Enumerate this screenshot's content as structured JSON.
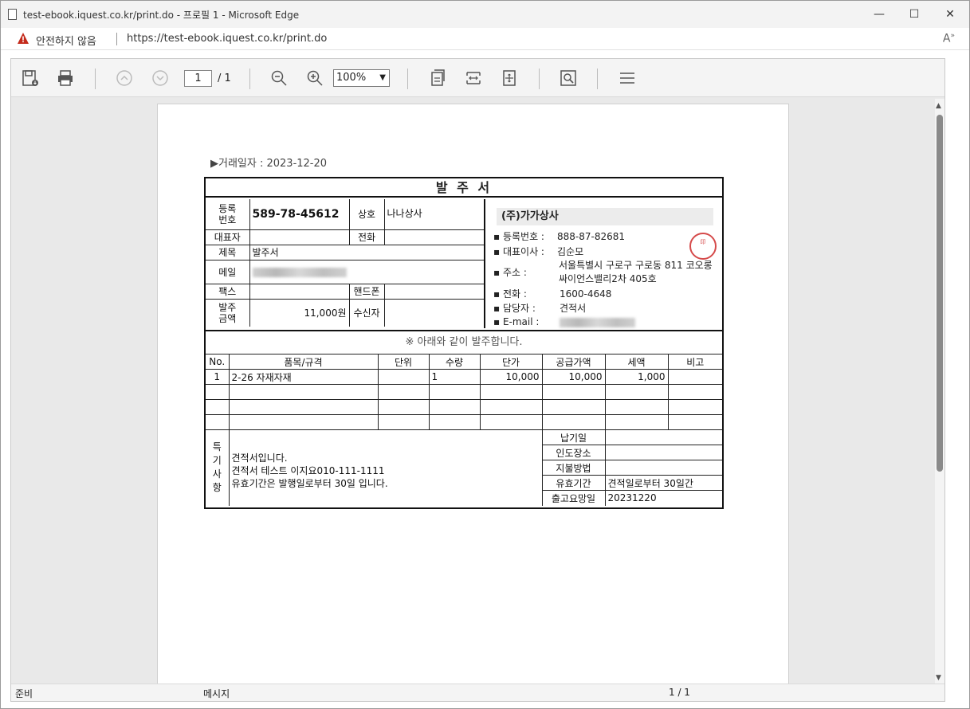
{
  "window": {
    "title": "test-ebook.iquest.co.kr/print.do - 프로필 1 - Microsoft Edge",
    "minimize": "—",
    "maximize": "☐",
    "close": "✕"
  },
  "address": {
    "warning": "안전하지 않음",
    "url": "https://test-ebook.iquest.co.kr/print.do"
  },
  "toolbar": {
    "page_current": "1",
    "page_total": "/ 1",
    "zoom": "100%"
  },
  "status": {
    "left": "준비",
    "middle": "메시지",
    "right": "1 / 1"
  },
  "doc": {
    "date_label": "▶거래일자 :  2023-12-20",
    "title": "발 주 서",
    "buyer": {
      "reg_label": "등록\n번호",
      "reg_no": "589-78-45612",
      "name_label": "상호",
      "name": "나나상사",
      "ceo_label": "대표자",
      "ceo": "",
      "phone_label": "전화",
      "phone": "",
      "subject_label": "제목",
      "subject": "발주서",
      "mail_label": "메일",
      "fax_label": "팩스",
      "fax": "",
      "mobile_label": "핸드폰",
      "mobile": "",
      "amount_label": "발주\n금액",
      "amount": "11,000원",
      "receiver_label": "수신자",
      "receiver": ""
    },
    "supplier": {
      "company": "(주)가가상사",
      "reg_label": "▪ 등록번호 :",
      "reg_no": "888-87-82681",
      "ceo_label": "▪ 대표이사 :",
      "ceo": "김순모",
      "addr_label": "▪ 주소 :",
      "addr1": "서울특별시 구로구 구로동 811 코오롱",
      "addr2": "싸이언스밸리2차 405호",
      "tel_label": "▪ 전화 :",
      "tel": "1600-4648",
      "manager_label": "▪ 담당자 :",
      "manager": "견적서",
      "email_label": "▪ E-mail :",
      "seal_text": "印"
    },
    "notice": "※ 아래와 같이 발주합니다.",
    "columns": [
      "No.",
      "품목/규격",
      "단위",
      "수량",
      "단가",
      "공급가액",
      "세액",
      "비고"
    ],
    "items": [
      [
        "1",
        "2-26  자재자재",
        "",
        "1",
        "10,000",
        "10,000",
        "1,000",
        ""
      ],
      [
        "",
        "",
        "",
        "",
        "",
        "",
        "",
        ""
      ],
      [
        "",
        "",
        "",
        "",
        "",
        "",
        "",
        ""
      ],
      [
        "",
        "",
        "",
        "",
        "",
        "",
        "",
        ""
      ]
    ],
    "remarks_label": "특\n기\n사\n항",
    "remarks": [
      "견적서입니다.",
      "견적서 테스트 이지요010-111-1111",
      "유효기간은 발행일로부터 30일 입니다."
    ],
    "terms": [
      {
        "k": "납기일",
        "v": ""
      },
      {
        "k": "인도장소",
        "v": ""
      },
      {
        "k": "지불방법",
        "v": ""
      },
      {
        "k": "유효기간",
        "v": "견적일로부터 30일간"
      },
      {
        "k": "출고요망일",
        "v": "20231220"
      }
    ]
  }
}
